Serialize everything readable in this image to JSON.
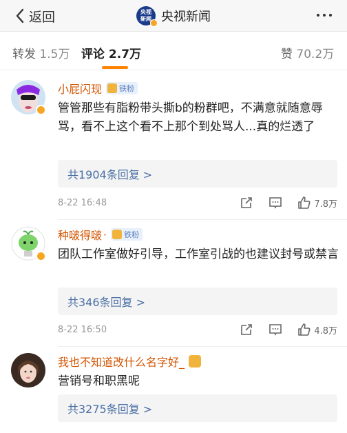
{
  "nav": {
    "back_label": "返回",
    "logo_text_top": "央视",
    "logo_text_bottom": "新闻",
    "title": "央视新闻"
  },
  "tabs": [
    {
      "label": "转发",
      "count": "1.5万"
    },
    {
      "label": "评论",
      "count": "2.7万"
    },
    {
      "label": "赞",
      "count": "70.2万"
    }
  ],
  "accent_color": "#ff8200",
  "comments": [
    {
      "username": "小屁闪现",
      "badge": "铁粉",
      "text": "管管那些有脂粉带头撕b的粉群吧，不满意就随意辱骂，看不上这个看不上那个到处骂人...真的烂透了",
      "replies": "共1904条回复 >",
      "time": "8-22 16:48",
      "likes": "7.8万"
    },
    {
      "username": "种啵得啵",
      "dot": "·",
      "badge": "铁粉",
      "text": "团队工作室做好引导，工作室引战的也建议封号或禁言",
      "replies": "共346条回复 >",
      "time": "8-22 16:50",
      "likes": "4.8万"
    },
    {
      "username": "我也不知道改什么名字好_",
      "text": "营销号和职黑呢",
      "replies": "共3275条回复 >"
    }
  ]
}
